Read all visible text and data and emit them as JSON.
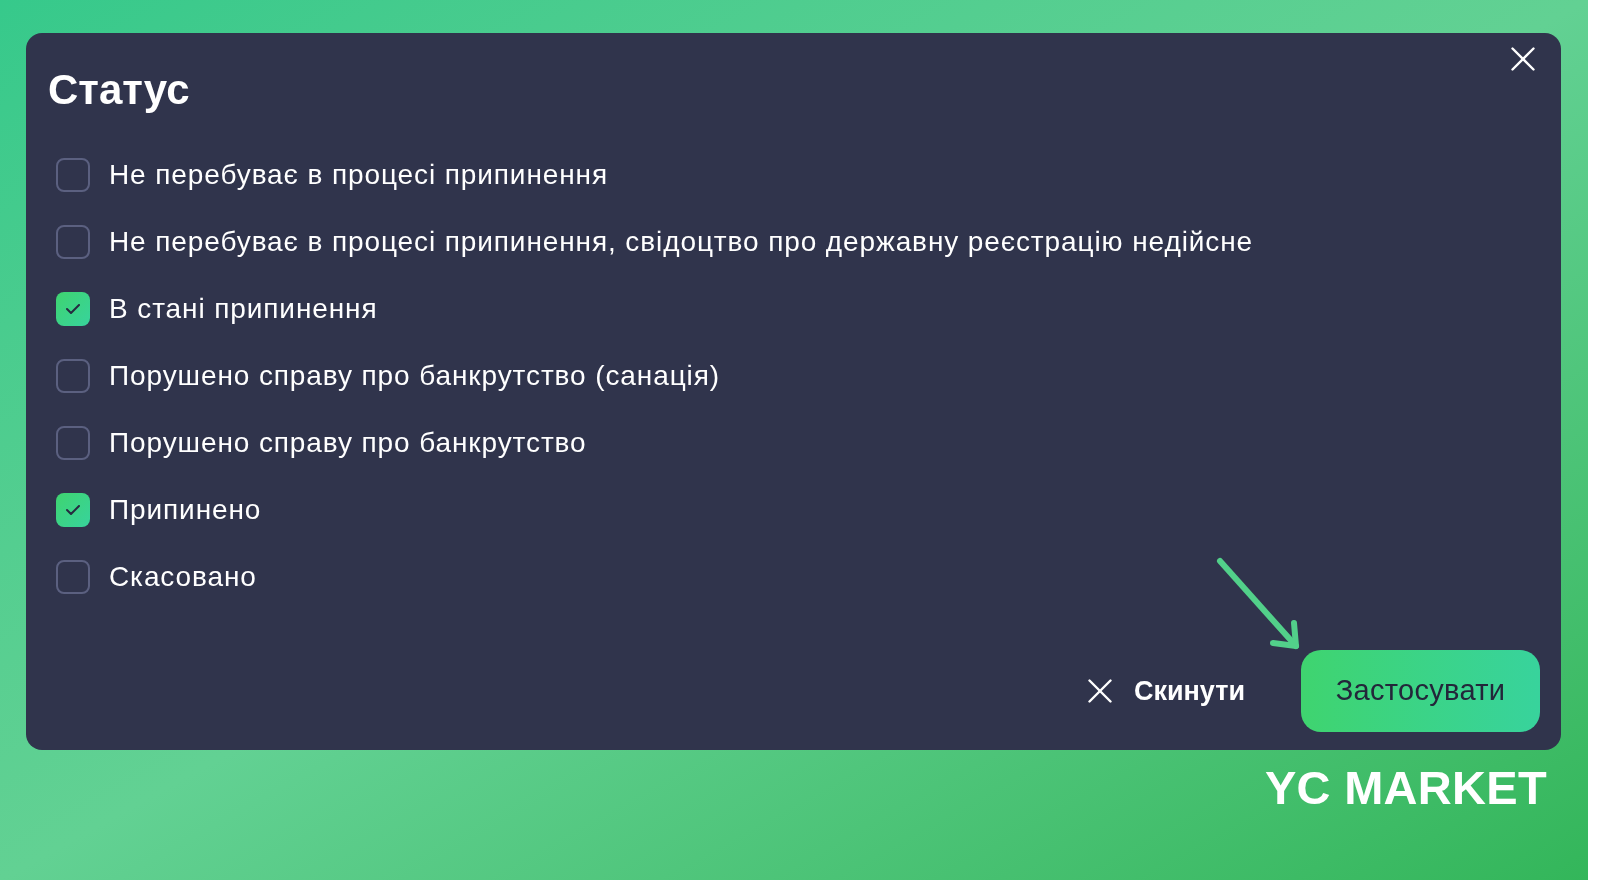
{
  "dialog": {
    "title": "Статус",
    "options": [
      {
        "label": "Не перебуває в процесі припинення",
        "checked": false
      },
      {
        "label": "Не перебуває в процесі припинення, свідоцтво про державну реєстрацію недійсне",
        "checked": false
      },
      {
        "label": "В стані припинення",
        "checked": true
      },
      {
        "label": "Порушено справу про банкрутство (санація)",
        "checked": false
      },
      {
        "label": "Порушено справу про банкрутство",
        "checked": false
      },
      {
        "label": "Припинено",
        "checked": true
      },
      {
        "label": "Скасовано",
        "checked": false
      }
    ],
    "buttons": [
      {
        "kind": "reset",
        "label": "Скинути"
      },
      {
        "kind": "apply",
        "label": "Застосувати"
      }
    ]
  },
  "logo": {
    "text": "YC MARKET"
  }
}
